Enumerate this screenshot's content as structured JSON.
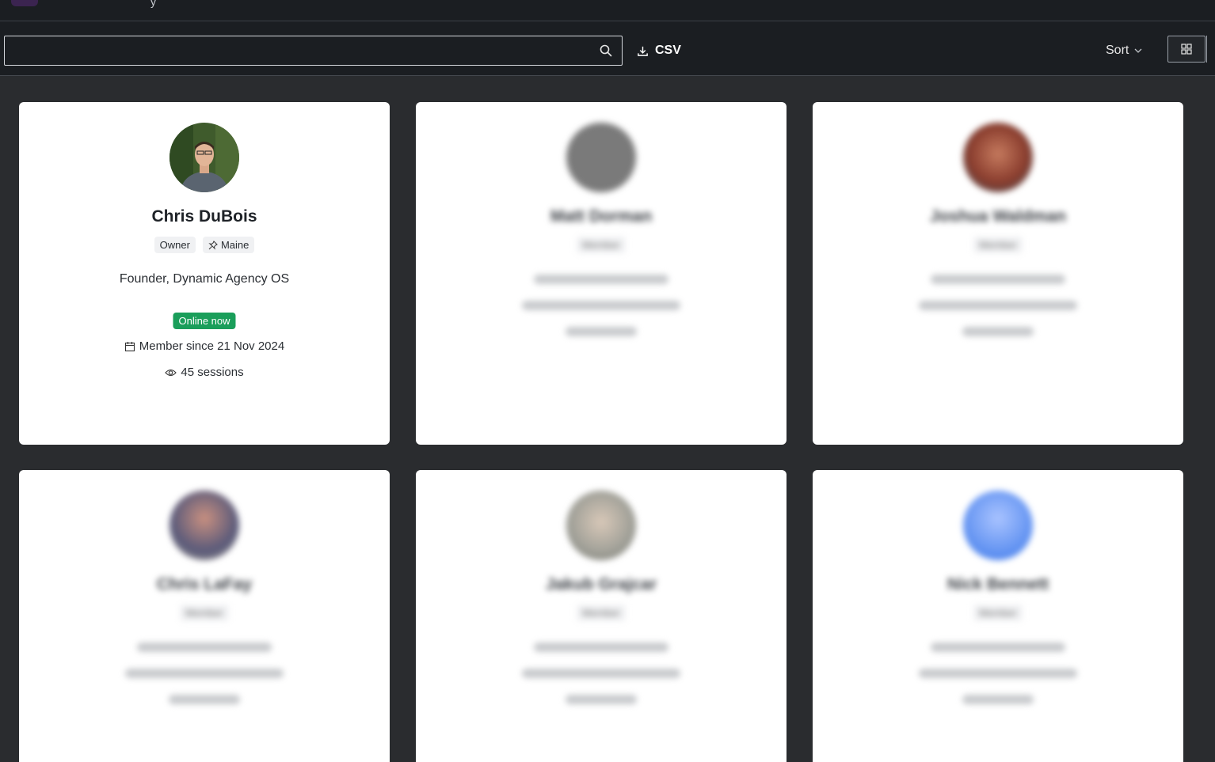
{
  "topbar": {
    "logo": "purple-logo",
    "cut_text": "y"
  },
  "toolbar": {
    "search_placeholder": "",
    "search_icon": "search-icon",
    "csv_label": "CSV",
    "csv_icon": "download-icon",
    "sort_label": "Sort",
    "sort_icon": "chevron-down-icon",
    "view_icon": "grid-icon"
  },
  "members": [
    {
      "name": "Chris DuBois",
      "role_tag": "Owner",
      "location": "Maine",
      "title": "Founder, Dynamic Agency OS",
      "status": "Online now",
      "member_since": "Member since 21 Nov 2024",
      "sessions": "45 sessions",
      "avatar_color": "#4c5a3a"
    },
    {
      "name": "Matt Dorman",
      "role_tag": "Member",
      "avatar_color": "#7a7a7a"
    },
    {
      "name": "Joshua Waldman",
      "role_tag": "Member",
      "avatar_color": "#8a4a3a"
    },
    {
      "name": "Chris LaFay",
      "role_tag": "Member",
      "avatar_color": "#6b5a6a"
    },
    {
      "name": "Jakub Grajcar",
      "role_tag": "Member",
      "avatar_color": "#a8a8a0"
    },
    {
      "name": "Nick Bennett",
      "role_tag": "Member",
      "avatar_color": "#5b8ef0"
    }
  ]
}
